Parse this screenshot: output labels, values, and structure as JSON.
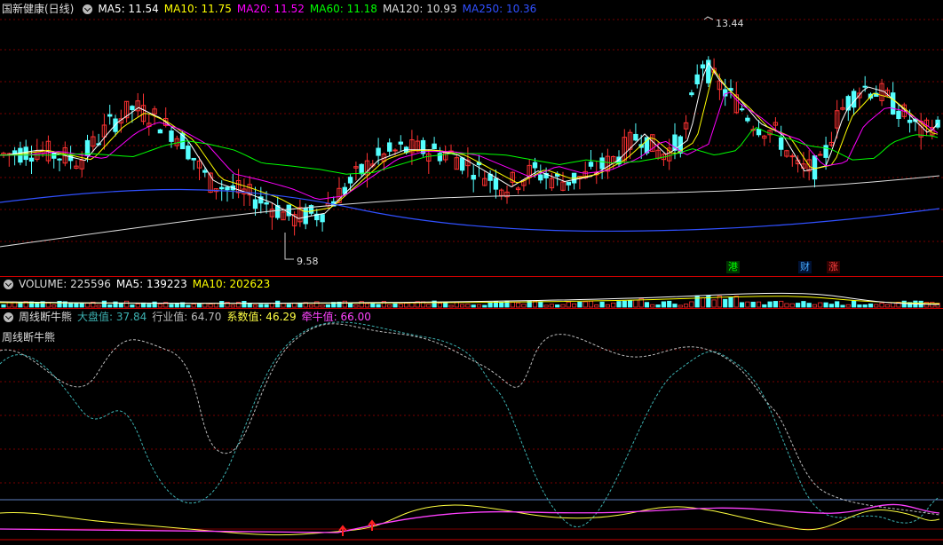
{
  "header": {
    "stock_name": "国新健康(日线)",
    "ma": [
      {
        "label": "MA5: 11.54",
        "color": "#ffffff"
      },
      {
        "label": "MA10: 11.75",
        "color": "#ffff00"
      },
      {
        "label": "MA20: 11.52",
        "color": "#ff00ff"
      },
      {
        "label": "MA60: 11.18",
        "color": "#00ff00"
      },
      {
        "label": "MA120: 10.93",
        "color": "#dddddd"
      },
      {
        "label": "MA250: 10.36",
        "color": "#3050ff"
      }
    ]
  },
  "price_chart": {
    "high_label": "13.44",
    "low_label": "9.58",
    "markers": [
      {
        "text": "港",
        "color": "#00ff00",
        "bg": "#003300"
      },
      {
        "text": "财",
        "color": "#44aaff",
        "bg": "#001133"
      },
      {
        "text": "涨",
        "color": "#ff4040",
        "bg": "#330000"
      }
    ]
  },
  "volume": {
    "title": "VOLUME: 225596",
    "ma5": "MA5: 139223",
    "ma10": "MA10: 202623"
  },
  "indicator": {
    "name": "周线断牛熊",
    "dapan": "大盘值: 37.84",
    "hangye": "行业值: 64.70",
    "xishu": "系数值: 46.29",
    "qianniu": "牵牛值: 66.00",
    "panel_label": "周线断牛熊"
  },
  "colors": {
    "up": "#ff3232",
    "down": "#54ffff",
    "dapan": "#3cb0b0",
    "hangye": "#bbbbbb",
    "xishu": "#ffff40",
    "qianniu": "#ff40ff"
  }
}
